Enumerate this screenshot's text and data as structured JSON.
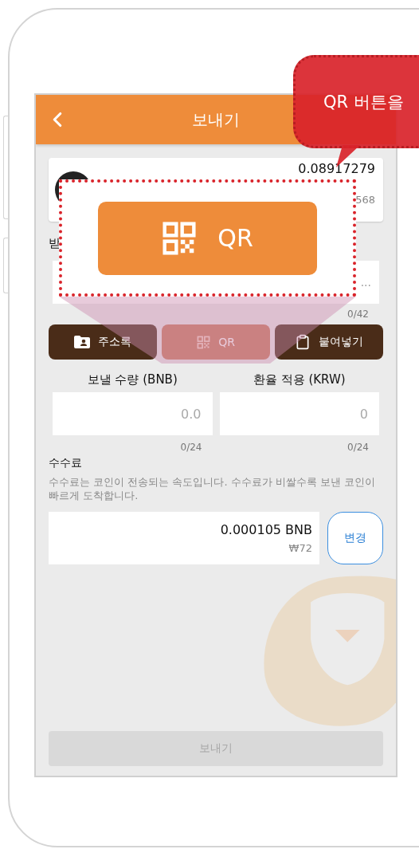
{
  "callout": {
    "text": "QR 버튼을"
  },
  "magnifier": {
    "button": {
      "label": "QR"
    }
  },
  "header": {
    "title": "보내기"
  },
  "coin_card": {
    "balance": "0.08917279",
    "fiat_fragment": "568"
  },
  "recipient": {
    "label_fragment": "받",
    "placeholder": "...",
    "counter": "0/42"
  },
  "actions": [
    {
      "kind": "address_book",
      "label": "주소록",
      "highlighted": false
    },
    {
      "kind": "qr",
      "label": "QR",
      "highlighted": true
    },
    {
      "kind": "paste",
      "label": "붙여넣기",
      "highlighted": false
    }
  ],
  "amounts": [
    {
      "label": "보낼 수량 (BNB)",
      "placeholder": "0.0",
      "counter": "0/24"
    },
    {
      "label": "환율 적용 (KRW)",
      "placeholder": "0",
      "counter": "0/24"
    }
  ],
  "fee": {
    "title": "수수료",
    "description": "수수료는 코인이 전송되는 속도입니다. 수수료가 비쌀수록 보낸 코인이 빠르게 도착합니다.",
    "amount": "0.000105 BNB",
    "fiat": "₩72",
    "change_button": "변경"
  },
  "send_button": {
    "label": "보내기",
    "disabled": true
  }
}
